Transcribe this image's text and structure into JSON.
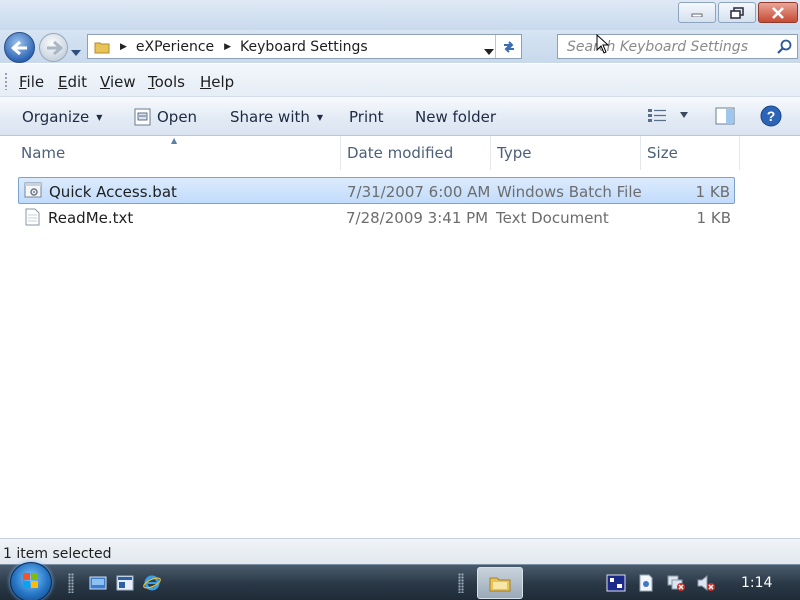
{
  "window": {
    "address_segments": [
      "eXPerience",
      "Keyboard Settings"
    ],
    "search_placeholder": "Search Keyboard Settings"
  },
  "menu": {
    "items": [
      {
        "label": "File",
        "accel": "F",
        "rest": "ile"
      },
      {
        "label": "Edit",
        "accel": "E",
        "rest": "dit"
      },
      {
        "label": "View",
        "accel": "V",
        "rest": "iew"
      },
      {
        "label": "Tools",
        "accel": "T",
        "rest": "ools"
      },
      {
        "label": "Help",
        "accel": "H",
        "rest": "elp"
      }
    ]
  },
  "toolbar": {
    "organize_label": "Organize",
    "open_label": "Open",
    "share_label": "Share with",
    "print_label": "Print",
    "new_folder_label": "New folder"
  },
  "columns": {
    "name": "Name",
    "date": "Date modified",
    "type": "Type",
    "size": "Size"
  },
  "files": [
    {
      "name": "Quick Access.bat",
      "date": "7/31/2007 6:00 AM",
      "type": "Windows Batch File",
      "size": "1 KB",
      "selected": true,
      "icon": "batch-file-icon"
    },
    {
      "name": "ReadMe.txt",
      "date": "7/28/2009 3:41 PM",
      "type": "Text Document",
      "size": "1 KB",
      "selected": false,
      "icon": "text-file-icon"
    }
  ],
  "status": {
    "text": "1 item selected"
  },
  "taskbar": {
    "clock": "1:14"
  },
  "colors": {
    "selection": "#cfe3fc",
    "selection_border": "#7da2ce",
    "taskbar": "#2a3846"
  }
}
